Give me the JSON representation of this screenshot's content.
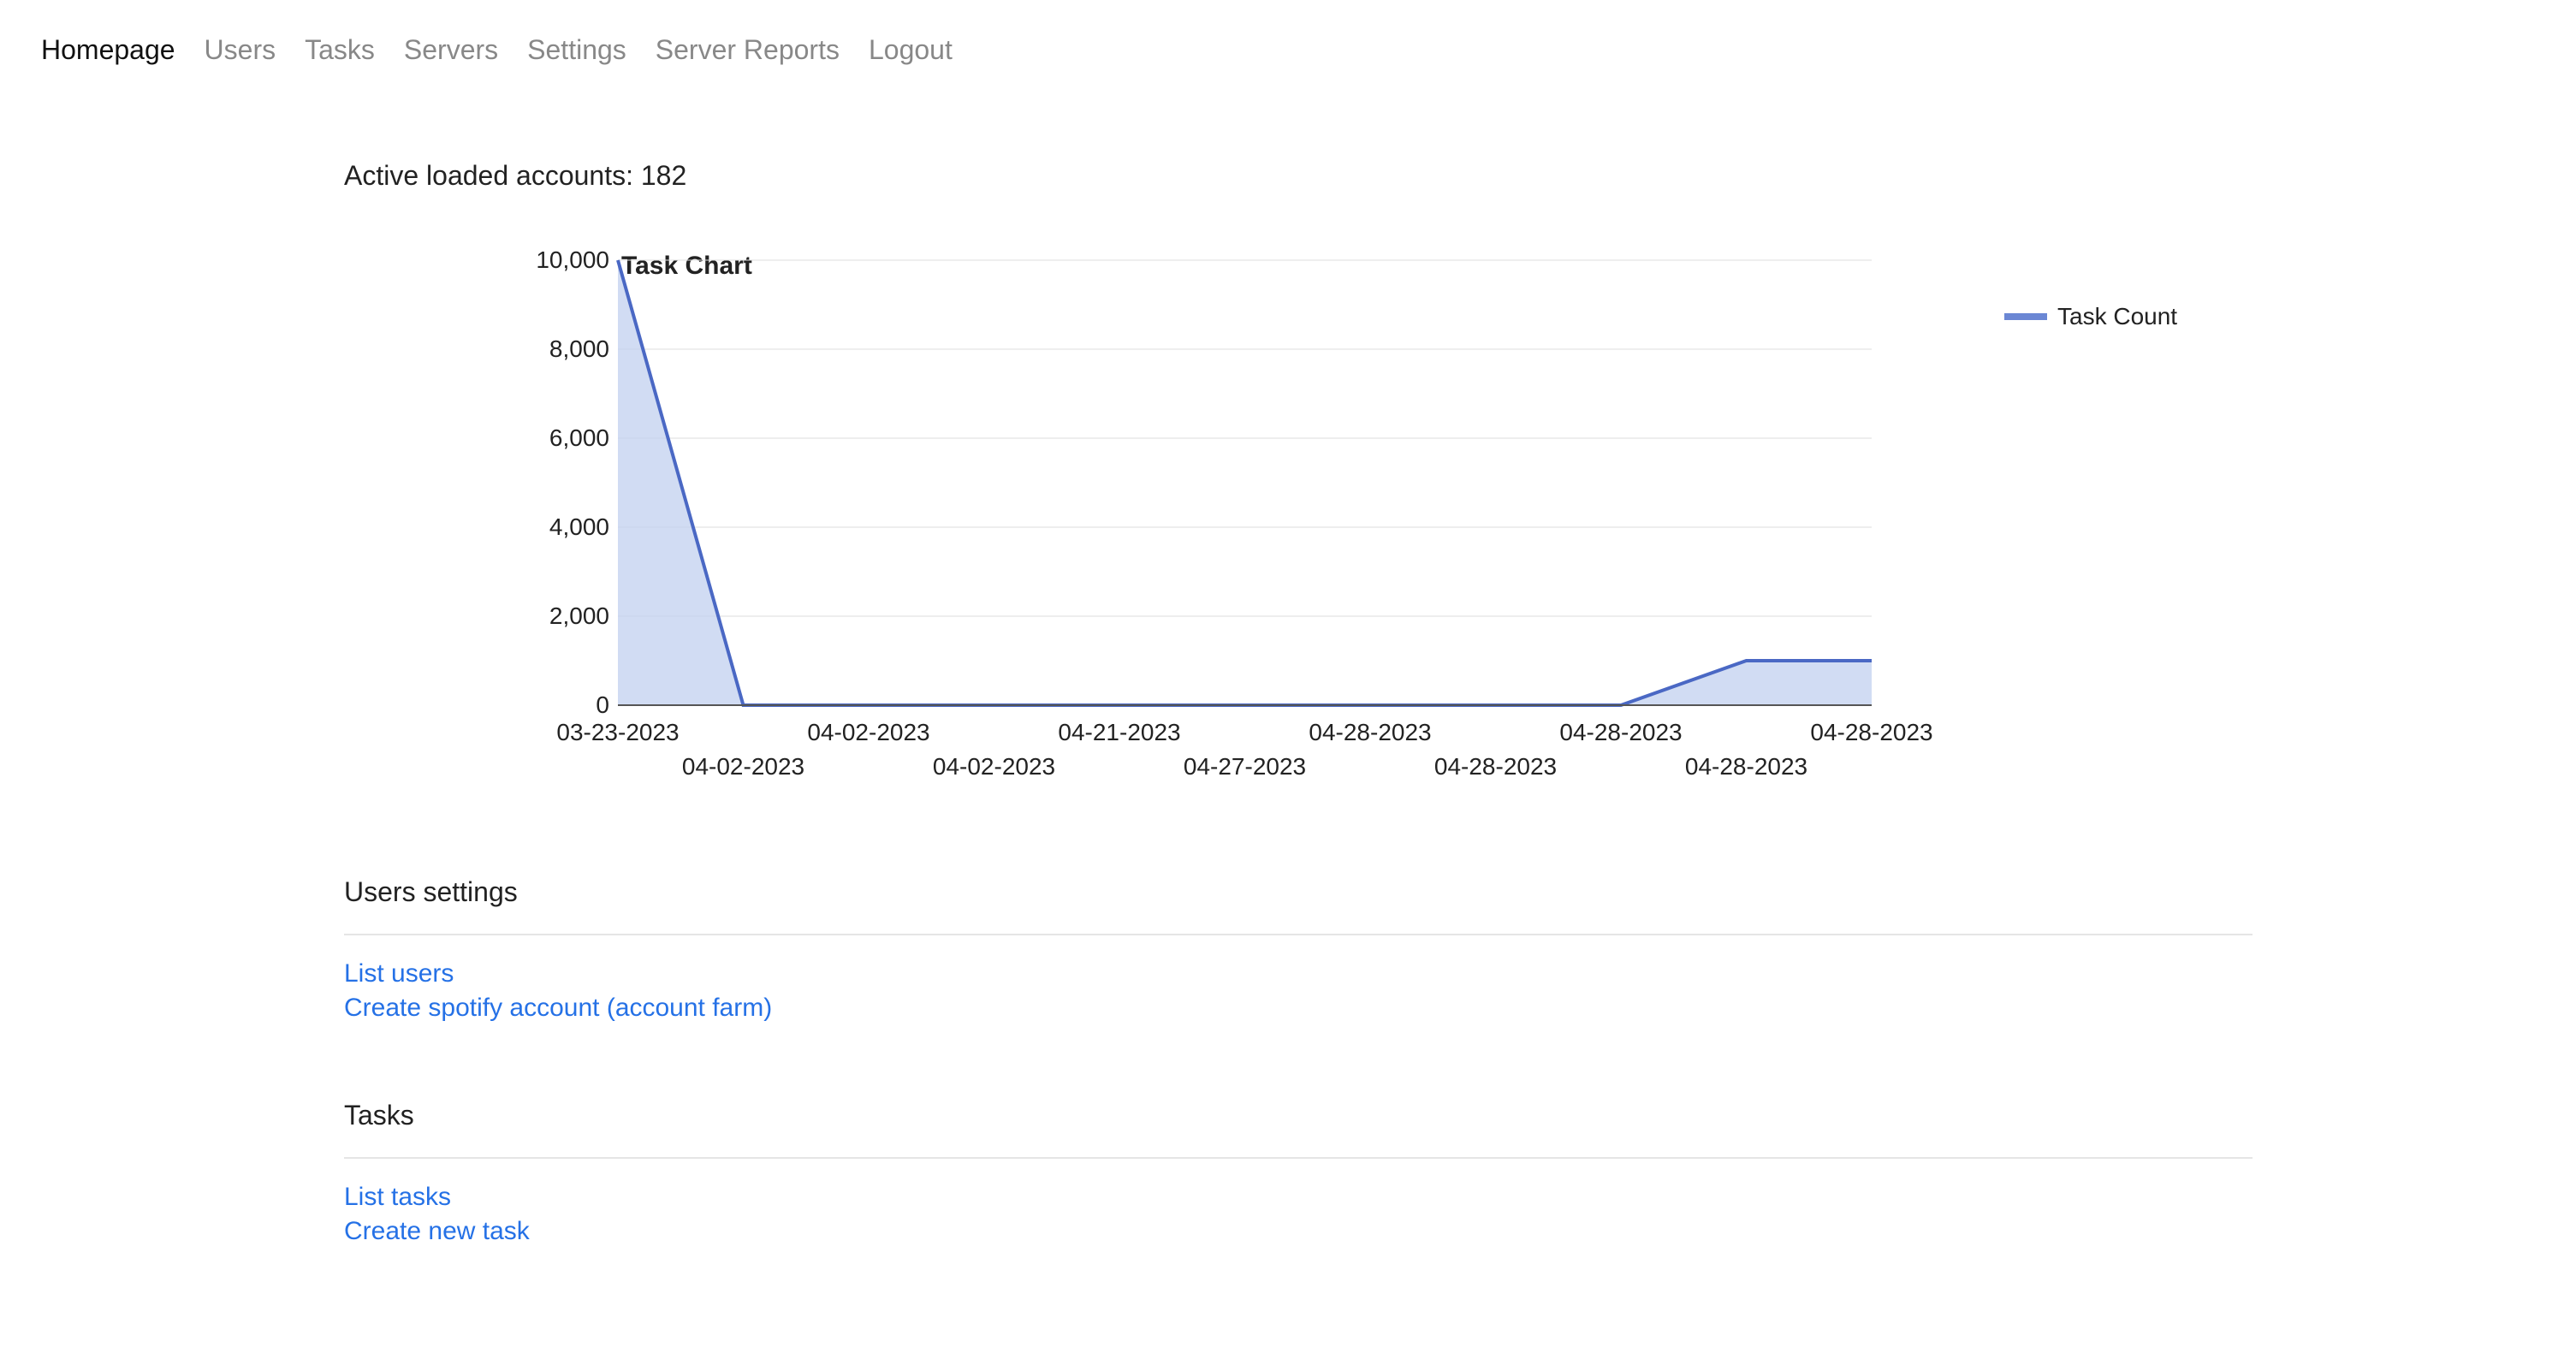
{
  "nav": {
    "items": [
      "Homepage",
      "Users",
      "Tasks",
      "Servers",
      "Settings",
      "Server Reports",
      "Logout"
    ],
    "active_index": 0
  },
  "stats": {
    "active_accounts_label": "Active loaded accounts: ",
    "active_accounts_value": "182"
  },
  "chart_data": {
    "type": "area",
    "title": "Task Chart",
    "legend": [
      "Task Count"
    ],
    "ylabel": "",
    "xlabel": "",
    "ylim": [
      0,
      10000
    ],
    "yticks": [
      0,
      2000,
      4000,
      6000,
      8000,
      10000
    ],
    "ytick_labels": [
      "0",
      "2,000",
      "4,000",
      "6,000",
      "8,000",
      "10,000"
    ],
    "categories": [
      "03-23-2023",
      "04-02-2023",
      "04-02-2023",
      "04-02-2023",
      "04-21-2023",
      "04-27-2023",
      "04-28-2023",
      "04-28-2023",
      "04-28-2023",
      "04-28-2023",
      "04-28-2023"
    ],
    "series": [
      {
        "name": "Task Count",
        "values": [
          10000,
          0,
          0,
          0,
          0,
          0,
          0,
          0,
          0,
          1000,
          1000
        ]
      }
    ],
    "colors": {
      "fill": "#c2d0ef",
      "stroke": "#4a68c4",
      "grid": "#dddddd",
      "axis": "#555555"
    }
  },
  "sections": [
    {
      "title": "Users settings",
      "links": [
        "List users",
        "Create spotify account (account farm)"
      ]
    },
    {
      "title": "Tasks",
      "links": [
        "List tasks",
        "Create new task"
      ]
    }
  ]
}
